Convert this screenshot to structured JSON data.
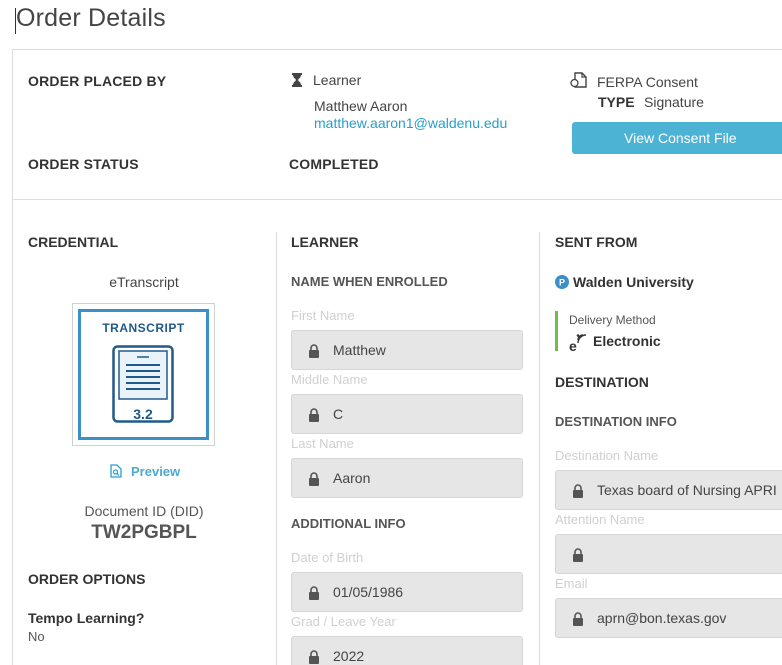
{
  "page": {
    "title": "Order Details"
  },
  "top": {
    "order_placed_by_label": "ORDER PLACED BY",
    "role": "Learner",
    "name": "Matthew Aaron",
    "email": "matthew.aaron1@waldenu.edu",
    "ferpa_label": "FERPA Consent",
    "type_label": "TYPE",
    "type_value": "Signature",
    "view_consent_button": "View Consent File",
    "order_status_label": "ORDER STATUS",
    "order_status_value": "COMPLETED"
  },
  "credential": {
    "heading": "CREDENTIAL",
    "doc_type": "eTranscript",
    "thumb_title": "TRANSCRIPT",
    "thumb_version": "3.2",
    "preview_link": "Preview",
    "did_label": "Document ID (DID)",
    "did_value": "TW2PGBPL",
    "order_options_heading": "ORDER OPTIONS",
    "tempo_label": "Tempo Learning?",
    "tempo_value": "No"
  },
  "learner": {
    "heading": "LEARNER",
    "name_when_enrolled": "NAME WHEN ENROLLED",
    "first_name_label": "First Name",
    "first_name": "Matthew",
    "middle_name_label": "Middle Name",
    "middle_name": "C",
    "last_name_label": "Last Name",
    "last_name": "Aaron",
    "additional_info": "ADDITIONAL INFO",
    "dob_label": "Date of Birth",
    "dob": "01/05/1986",
    "grad_label": "Grad / Leave Year",
    "grad": "2022"
  },
  "sent_from": {
    "heading": "SENT FROM",
    "institution": "Walden University",
    "delivery_label": "Delivery Method",
    "delivery_value": "Electronic"
  },
  "destination": {
    "heading": "DESTINATION",
    "info_heading": "DESTINATION INFO",
    "dest_name_label": "Destination Name",
    "dest_name": "Texas board of Nursing APRI",
    "attention_label": "Attention Name",
    "attention": "",
    "email_label": "Email",
    "email": "aprn@bon.texas.gov"
  },
  "colors": {
    "accent": "#4db3d4",
    "link": "#2a9fc9",
    "delivery_bar": "#6cc04a",
    "transcript_blue": "#3d8fc8"
  }
}
